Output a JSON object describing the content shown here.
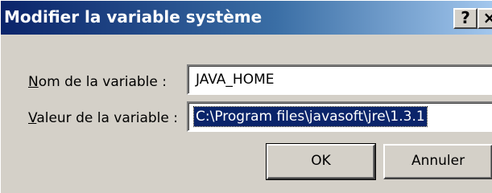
{
  "window": {
    "title": "Modifier la variable système",
    "help_button": "?",
    "close_button": "×"
  },
  "form": {
    "name_label_accel": "N",
    "name_label_rest": "om de la variable :",
    "name_value": "JAVA_HOME",
    "value_label_accel": "V",
    "value_label_rest": "aleur de la variable :",
    "value_value": "C:\\Program files\\javasoft\\jre\\1.3.1"
  },
  "buttons": {
    "ok": "OK",
    "cancel": "Annuler"
  },
  "colors": {
    "title_gradient_start": "#0a246a",
    "title_gradient_end": "#a6caf0",
    "dialog_face": "#d4d0c8",
    "selection": "#0a246a"
  }
}
